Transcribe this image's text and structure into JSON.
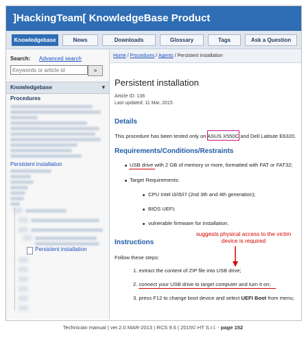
{
  "header": {
    "title": "]HackingTeam[ KnowledgeBase Product"
  },
  "nav": {
    "tabs": [
      "Knowledgebase",
      "News",
      "Downloads",
      "Glossary",
      "Tags",
      "Ask a Question"
    ],
    "active_index": 0
  },
  "sidebar": {
    "search_label": "Search:",
    "advanced_search": "Advanced search",
    "search_placeholder": "Keywords or article id",
    "search_button": "»",
    "kb_section": "Knowledgebase",
    "procedures_label": "Procedures",
    "persistent_item": "Persistent installation",
    "tree_current": "Persistent installation"
  },
  "breadcrumb": {
    "home": "Home",
    "procedures": "Procedures",
    "agents": "Agents",
    "current": "Persistent installation",
    "separator": "/"
  },
  "article": {
    "title": "Persistent installation",
    "article_id": "Article ID: 138",
    "last_updated": "Last updated: 11 Mar, 2015",
    "details_heading": "Details",
    "details_text_prefix": "This procedure has been tested only on",
    "details_highlight": "ASUS X550C",
    "details_text_suffix": "and Dell Latitute E6320.",
    "requirements_heading": "Requirements/Conditions/Restraints",
    "req_usb_highlight": "USB drive",
    "req_usb_rest": "with 2 GB of memory or more, formatted with FAT or FAT32;",
    "req_target": "Target Requirements:",
    "req_sub": [
      "CPU Intel i3/i5/i7 (2nd 3th and 4th generation);",
      "BIOS UEFI;",
      "vulnerable firmware for installation."
    ],
    "instructions_heading": "Instructions",
    "follow_steps": "Follow these steps:",
    "steps": [
      "1. extract the content of ZIP file into USB drive;",
      "2. connect your USB drive to target computer and turn it on;",
      "3. press F12 to change boot device and select"
    ],
    "step3_bold": "UEFI Boot",
    "step3_end": "from menu;"
  },
  "annotation": {
    "text": "suggests physical access to the victim device is required",
    "color": "#d40000"
  },
  "footer": {
    "prefix": "Technician manual | ver.2.0 MAR-2013 | RCS 9.6 | 2015© HT S.r.l. - ",
    "page_label": "page 152"
  },
  "colors": {
    "header_bg": "#2f6db4",
    "heading_blue": "#1f5aa6",
    "link_blue": "#1a4fc0",
    "highlight_box": "#c0187f",
    "underline_red": "#d40000"
  }
}
